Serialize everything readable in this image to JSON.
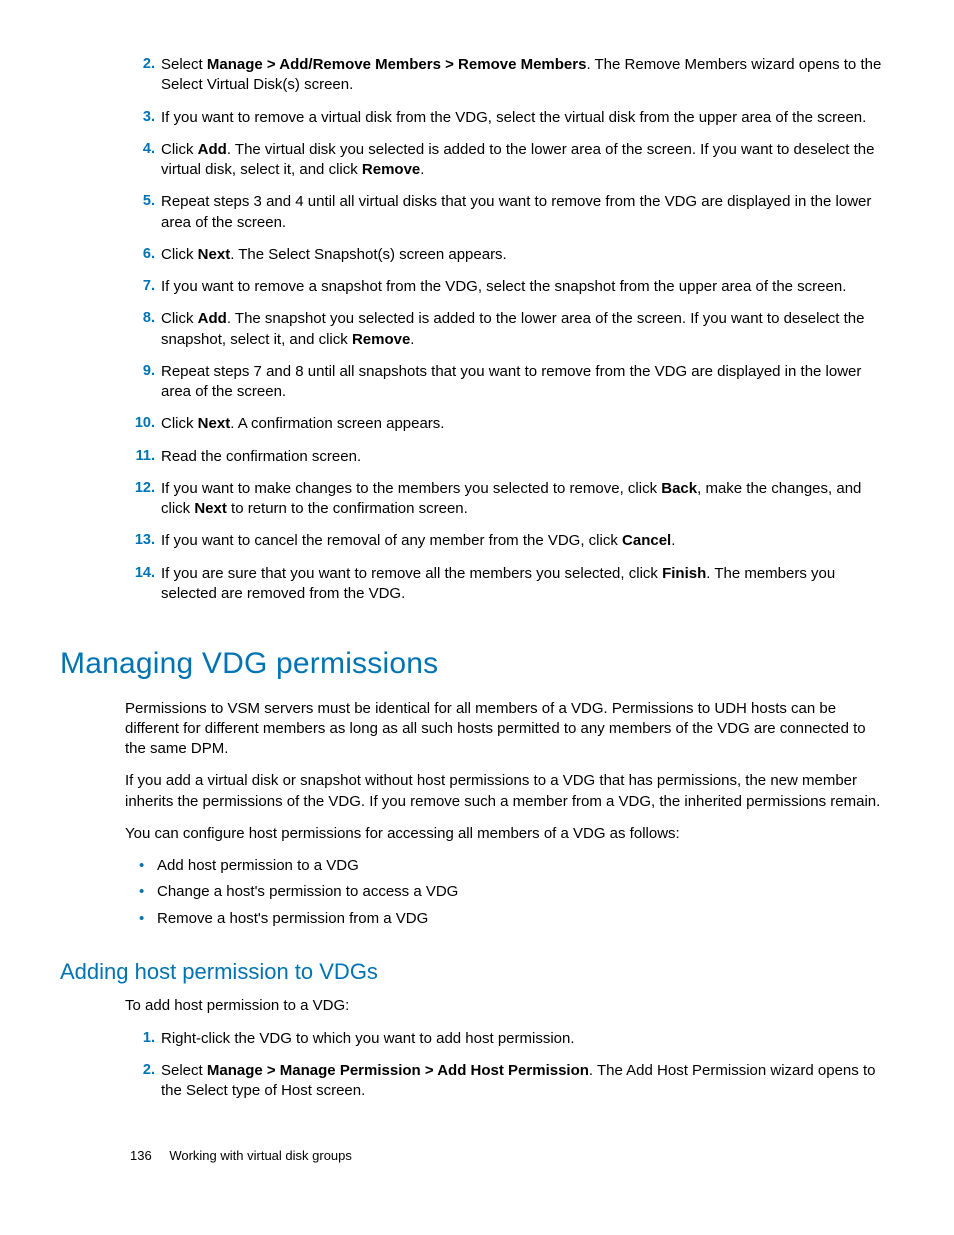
{
  "steps_a": [
    {
      "n": "2.",
      "segs": [
        {
          "t": "Select "
        },
        {
          "t": "Manage > Add/Remove Members > Remove Members",
          "b": true
        },
        {
          "t": ". The Remove Members wizard opens to the Select Virtual Disk(s) screen."
        }
      ]
    },
    {
      "n": "3.",
      "segs": [
        {
          "t": "If you want to remove a virtual disk from the VDG, select the virtual disk from the upper area of the screen."
        }
      ]
    },
    {
      "n": "4.",
      "segs": [
        {
          "t": "Click "
        },
        {
          "t": "Add",
          "b": true
        },
        {
          "t": ". The virtual disk you selected is added to the lower area of the screen. If you want to deselect the virtual disk, select it, and click "
        },
        {
          "t": "Remove",
          "b": true
        },
        {
          "t": "."
        }
      ]
    },
    {
      "n": "5.",
      "segs": [
        {
          "t": "Repeat steps 3 and 4 until all virtual disks that you want to remove from the VDG are displayed in the lower area of the screen."
        }
      ]
    },
    {
      "n": "6.",
      "segs": [
        {
          "t": "Click "
        },
        {
          "t": "Next",
          "b": true
        },
        {
          "t": ". The Select Snapshot(s) screen appears."
        }
      ]
    },
    {
      "n": "7.",
      "segs": [
        {
          "t": "If you want to remove a snapshot from the VDG, select the snapshot from the upper area of the screen."
        }
      ]
    },
    {
      "n": "8.",
      "segs": [
        {
          "t": "Click "
        },
        {
          "t": "Add",
          "b": true
        },
        {
          "t": ". The snapshot you selected is added to the lower area of the screen. If you want to deselect the snapshot, select it, and click "
        },
        {
          "t": "Remove",
          "b": true
        },
        {
          "t": "."
        }
      ]
    },
    {
      "n": "9.",
      "segs": [
        {
          "t": "Repeat steps 7 and 8 until all snapshots that you want to remove from the VDG are displayed in the lower area of the screen."
        }
      ]
    },
    {
      "n": "10.",
      "segs": [
        {
          "t": "Click "
        },
        {
          "t": "Next",
          "b": true
        },
        {
          "t": ". A confirmation screen appears."
        }
      ]
    },
    {
      "n": "11.",
      "segs": [
        {
          "t": "Read the confirmation screen."
        }
      ]
    },
    {
      "n": "12.",
      "segs": [
        {
          "t": "If you want to make changes to the members you selected to remove, click "
        },
        {
          "t": "Back",
          "b": true
        },
        {
          "t": ", make the changes, and click "
        },
        {
          "t": "Next",
          "b": true
        },
        {
          "t": " to return to the confirmation screen."
        }
      ]
    },
    {
      "n": "13.",
      "segs": [
        {
          "t": "If you want to cancel the removal of any member from the VDG, click "
        },
        {
          "t": "Cancel",
          "b": true
        },
        {
          "t": "."
        }
      ]
    },
    {
      "n": "14.",
      "segs": [
        {
          "t": "If you are sure that you want to remove all the members you selected, click "
        },
        {
          "t": "Finish",
          "b": true
        },
        {
          "t": ". The members you selected are removed from the VDG."
        }
      ]
    }
  ],
  "h1": "Managing VDG permissions",
  "p1": "Permissions to VSM servers must be identical for all members of a VDG. Permissions to UDH hosts can be different for different members as long as all such hosts permitted to any members of the VDG are connected to the same DPM.",
  "p2": "If you add a virtual disk or snapshot without host permissions to a VDG that has permissions, the new member inherits the permissions of the VDG. If you remove such a member from a VDG, the inherited permissions remain.",
  "p3": "You can configure host permissions for accessing all members of a VDG as follows:",
  "bullets": [
    "Add host permission to a VDG",
    "Change a host's permission to access a VDG",
    "Remove a host's permission from a VDG"
  ],
  "h2": "Adding host permission to VDGs",
  "p4": "To add host permission to a VDG:",
  "steps_b": [
    {
      "n": "1.",
      "segs": [
        {
          "t": "Right-click the VDG to which you want to add host permission."
        }
      ]
    },
    {
      "n": "2.",
      "segs": [
        {
          "t": "Select "
        },
        {
          "t": "Manage > Manage Permission > Add Host Permission",
          "b": true
        },
        {
          "t": ". The Add Host Permission wizard opens to the Select type of Host screen."
        }
      ]
    }
  ],
  "footer": {
    "page": "136",
    "chapter": "Working with virtual disk groups"
  }
}
